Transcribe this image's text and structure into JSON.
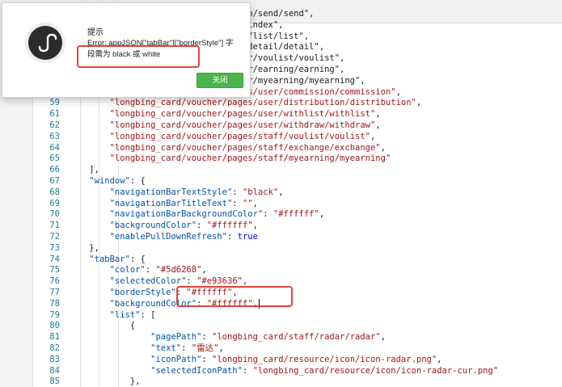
{
  "dialog": {
    "title": "提示",
    "message_line1": "Error: appJSON[\"tabBar\"][\"borderStyle\"] 字",
    "message_line2": "段需为 black 或 white",
    "close_button": "关闭",
    "logo_icon": "miniprogram-icon"
  },
  "editor": {
    "lines": [
      {
        "n": "",
        "c": "                                  pp/send/send\","
      },
      {
        "n": "",
        "c": "                                  /index\","
      },
      {
        "n": "",
        "c": "                                  t/list/list\","
      },
      {
        "n": "",
        "c": "                                  /detail/detail\","
      },
      {
        "n": "",
        "c": "                                  er/voulist/voulist\","
      },
      {
        "n": "",
        "c": "                                  er/earning/earning\","
      },
      {
        "n": "",
        "c": "                                  er/myearning/myearning\","
      },
      {
        "n": "",
        "c": "        \"longbing_card/voucher/pages/user/commission/commission\","
      },
      {
        "n": "59",
        "c": "        \"longbing_card/voucher/pages/user/distribution/distribution\","
      },
      {
        "n": "61",
        "c": "        \"longbing_card/voucher/pages/user/withlist/withlist\","
      },
      {
        "n": "62",
        "c": "        \"longbing_card/voucher/pages/user/withdraw/withdraw\","
      },
      {
        "n": "63",
        "c": "        \"longbing_card/voucher/pages/staff/voulist/voulist\","
      },
      {
        "n": "64",
        "c": "        \"longbing_card/voucher/pages/staff/exchange/exchange\","
      },
      {
        "n": "65",
        "c": "        \"longbing_card/voucher/pages/staff/myearning/myearning\""
      },
      {
        "n": "66",
        "c": "    ],"
      },
      {
        "n": "67",
        "c": "    \"window\": {"
      },
      {
        "n": "68",
        "c": "        \"navigationBarTextStyle\": \"black\","
      },
      {
        "n": "69",
        "c": "        \"navigationBarTitleText\": \"\","
      },
      {
        "n": "70",
        "c": "        \"navigationBarBackgroundColor\": \"#ffffff\","
      },
      {
        "n": "71",
        "c": "        \"backgroundColor\": \"#ffffff\","
      },
      {
        "n": "72",
        "c": "        \"enablePullDownRefresh\": true"
      },
      {
        "n": "73",
        "c": "    },"
      },
      {
        "n": "74",
        "c": "    \"tabBar\": {"
      },
      {
        "n": "75",
        "c": "        \"color\": \"#5d6268\","
      },
      {
        "n": "76",
        "c": "        \"selectedColor\": \"#e93636\","
      },
      {
        "n": "77",
        "c": "        \"borderStyle\": \"#ffffff\","
      },
      {
        "n": "78",
        "c": "        \"backgroundColor\": \"#ffffff\","
      },
      {
        "n": "79",
        "c": "        \"list\": ["
      },
      {
        "n": "80",
        "c": "            {"
      },
      {
        "n": "81",
        "c": "                \"pagePath\": \"longbing_card/staff/radar/radar\","
      },
      {
        "n": "82",
        "c": "                \"text\": \"雷达\","
      },
      {
        "n": "83",
        "c": "                \"iconPath\": \"longbing_card/resource/icon/icon-radar.png\","
      },
      {
        "n": "84",
        "c": "                \"selectedIconPath\": \"longbing_card/resource/icon/icon-radar-cur.png\""
      },
      {
        "n": "85",
        "c": "            },"
      }
    ]
  },
  "colors": {
    "highlight": "#e0443a",
    "button": "#49b54a",
    "line_number": "#237893",
    "string": "#a31515",
    "keyword": "#0000ff"
  }
}
